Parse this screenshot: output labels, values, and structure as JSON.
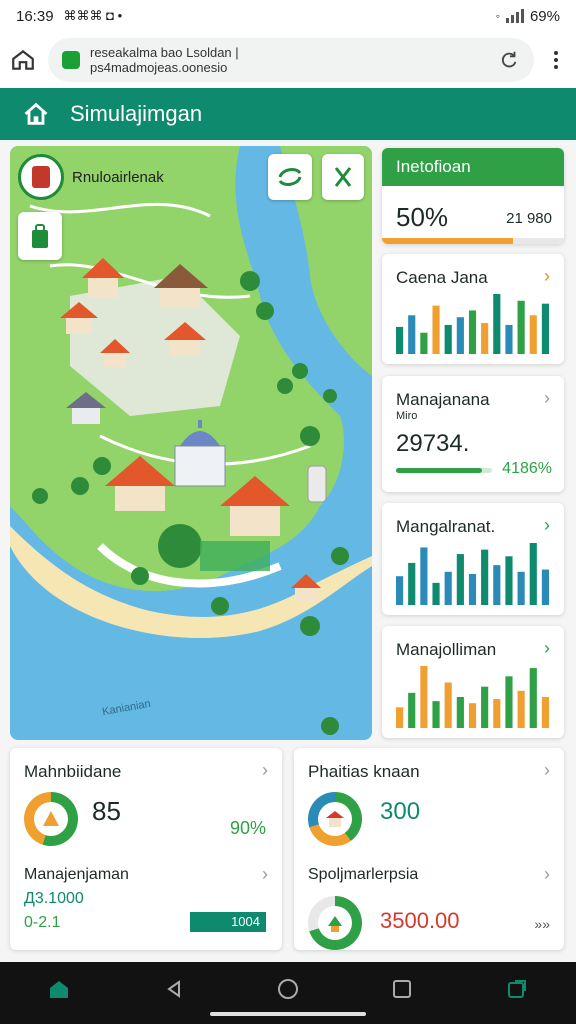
{
  "status_bar": {
    "time": "16:39",
    "extra": "⌘⌘⌘ ◘ •",
    "battery": "69%"
  },
  "browser": {
    "url_line1": "reseakalma bao Lsoldan |",
    "url_line2": "ps4madmojeas.oonesio"
  },
  "app": {
    "title": "Simulajimgan"
  },
  "map": {
    "badge_label": "Rnuloairlenak",
    "watermark": "Kanianian"
  },
  "cards": {
    "info": {
      "title": "Inetofioan",
      "percent": "50%",
      "value": "21 980",
      "progress": 0.72
    },
    "c1": {
      "title": "Caena Jana",
      "bars": [
        28,
        40,
        22,
        50,
        30,
        38,
        45,
        32,
        62,
        30,
        55,
        40,
        52
      ]
    },
    "c2": {
      "title": "Manajanana",
      "subtitle": "Miro",
      "value": "29734.",
      "pct": "4186%",
      "progress": 0.9
    },
    "c3": {
      "title": "Mangalranat.",
      "bars": [
        26,
        38,
        52,
        20,
        30,
        46,
        28,
        50,
        36,
        44,
        30,
        56,
        32
      ]
    },
    "c4": {
      "title": "Manajolliman",
      "bars": [
        20,
        34,
        60,
        26,
        44,
        30,
        24,
        40,
        28,
        50,
        36,
        58,
        30
      ]
    },
    "bl": {
      "title": "Mahnbiidane",
      "value": "85",
      "pct": "90%",
      "sub_title": "Manajenjaman",
      "sub_v1": "Д3.1000",
      "sub_v2": "0-2.1",
      "button": "1004"
    },
    "br": {
      "title": "Phaitias knaan",
      "value": "300",
      "sub_title": "Spoljmarlerpsia",
      "sub_value": "3500.00",
      "sub_chev": "»»"
    }
  },
  "colors": {
    "teal": "#0e8a6e",
    "green": "#2fa045",
    "orange": "#f0a030",
    "blue": "#2a8ab8",
    "red": "#d33a2f"
  }
}
